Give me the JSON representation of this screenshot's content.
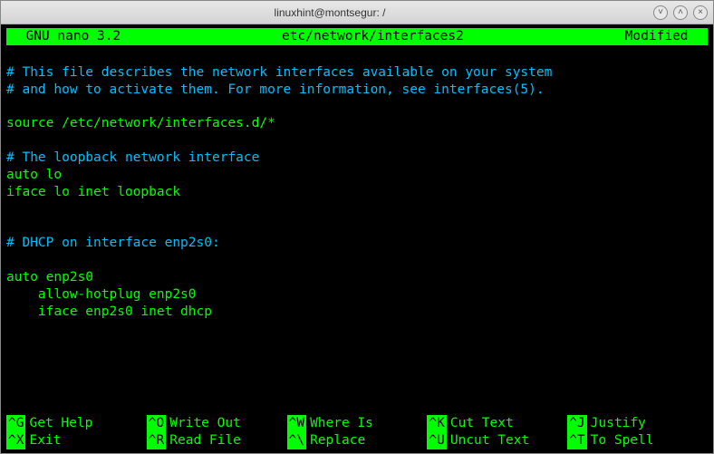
{
  "window": {
    "title": "linuxhint@montsegur: /"
  },
  "nano": {
    "version": "  GNU nano 3.2",
    "filename": "etc/network/interfaces2",
    "status": "Modified  "
  },
  "lines": [
    {
      "text": "",
      "comment": false
    },
    {
      "text": "# This file describes the network interfaces available on your system",
      "comment": true
    },
    {
      "text": "# and how to activate them. For more information, see interfaces(5).",
      "comment": true
    },
    {
      "text": "",
      "comment": false
    },
    {
      "text": "source /etc/network/interfaces.d/*",
      "comment": false
    },
    {
      "text": "",
      "comment": false
    },
    {
      "text": "# The loopback network interface",
      "comment": true
    },
    {
      "text": "auto lo",
      "comment": false
    },
    {
      "text": "iface lo inet loopback",
      "comment": false
    },
    {
      "text": "",
      "comment": false
    },
    {
      "text": "",
      "comment": false
    },
    {
      "text": "# DHCP on interface enp2s0:",
      "comment": true
    },
    {
      "text": "",
      "comment": false
    },
    {
      "text": "auto enp2s0",
      "comment": false
    },
    {
      "text": "    allow-hotplug enp2s0",
      "comment": false
    },
    {
      "text": "    iface enp2s0 inet dhcp",
      "comment": false
    },
    {
      "text": "",
      "comment": false
    },
    {
      "text": "",
      "comment": false
    }
  ],
  "shortcuts": {
    "row1": [
      {
        "key": "^G",
        "label": "Get Help"
      },
      {
        "key": "^O",
        "label": "Write Out"
      },
      {
        "key": "^W",
        "label": "Where Is"
      },
      {
        "key": "^K",
        "label": "Cut Text"
      },
      {
        "key": "^J",
        "label": "Justify"
      }
    ],
    "row2": [
      {
        "key": "^X",
        "label": "Exit"
      },
      {
        "key": "^R",
        "label": "Read File"
      },
      {
        "key": "^\\",
        "label": "Replace"
      },
      {
        "key": "^U",
        "label": "Uncut Text"
      },
      {
        "key": "^T",
        "label": "To Spell"
      }
    ]
  }
}
